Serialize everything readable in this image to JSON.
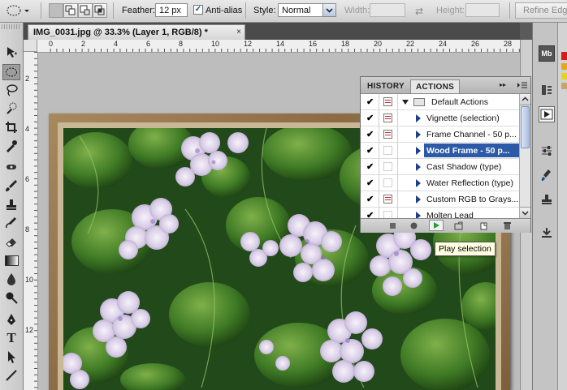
{
  "options_bar": {
    "feather_label": "Feather:",
    "feather_value": "12 px",
    "anti_alias_label": "Anti-alias",
    "style_label": "Style:",
    "style_value": "Normal",
    "width_label": "Width:",
    "height_label": "Height:",
    "refine_edge_label": "Refine Edge..."
  },
  "document": {
    "tab_title": "IMG_0031.jpg @ 33.3% (Layer 1, RGB/8) *",
    "close_glyph": "×"
  },
  "rulers": {
    "h_ticks": [
      "0",
      "2",
      "4",
      "6",
      "8",
      "10",
      "12",
      "14",
      "16",
      "18",
      "20",
      "22",
      "24",
      "26",
      "28"
    ],
    "v_ticks": [
      "2",
      "4",
      "6",
      "8",
      "10",
      "12"
    ]
  },
  "panel": {
    "tabs": [
      "HISTORY",
      "ACTIONS"
    ],
    "active_tab": "ACTIONS",
    "set_name": "Default Actions",
    "actions": [
      {
        "label": "Vignette (selection)",
        "dialog": true,
        "selected": false
      },
      {
        "label": "Frame Channel - 50 p...",
        "dialog": true,
        "selected": false
      },
      {
        "label": "Wood Frame - 50 p...",
        "dialog": false,
        "selected": true
      },
      {
        "label": "Cast Shadow (type)",
        "dialog": false,
        "selected": false
      },
      {
        "label": "Water Reflection (type)",
        "dialog": false,
        "selected": false
      },
      {
        "label": "Custom RGB to Grays...",
        "dialog": true,
        "selected": false
      },
      {
        "label": "Molten Lead",
        "dialog": false,
        "selected": false
      }
    ],
    "check_glyph": "✔"
  },
  "tooltip": {
    "text": "Play selection"
  },
  "dock": {
    "minibridge_label": "Mb"
  },
  "colors": {
    "selection": "#2d5aa7",
    "play": "#2e9b3a",
    "dialog_icon": "#c0282a"
  }
}
